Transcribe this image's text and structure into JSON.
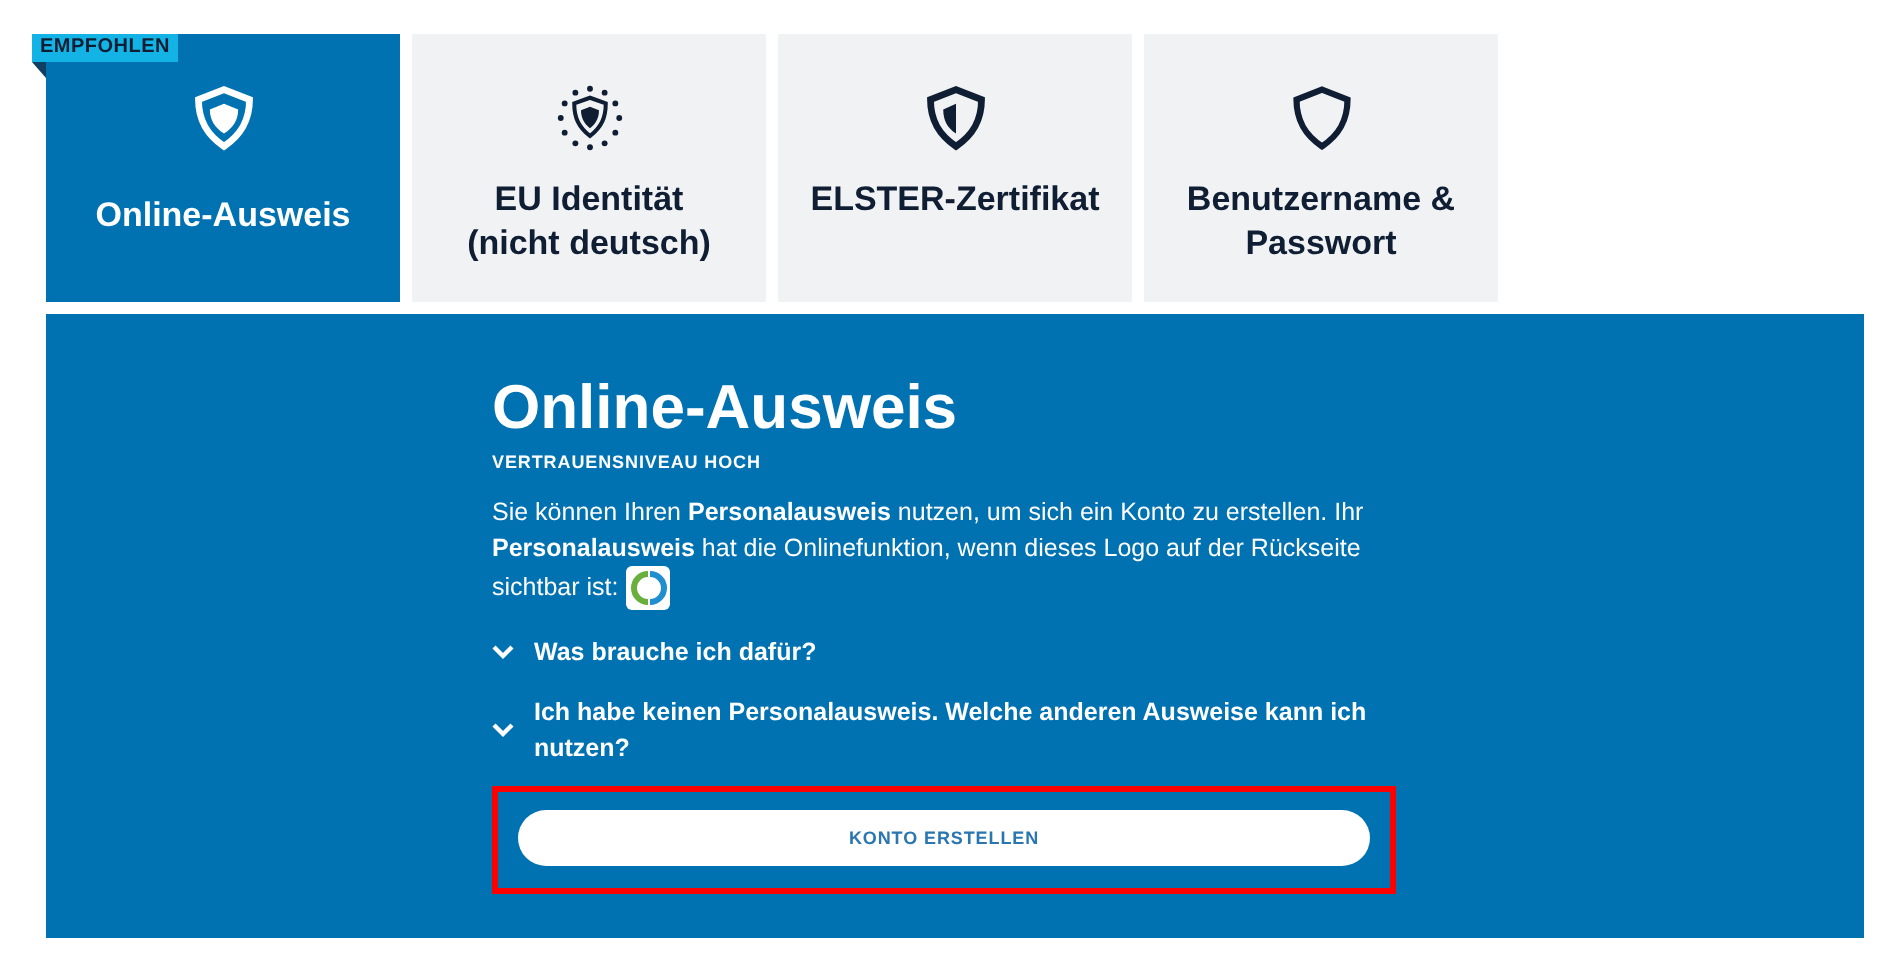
{
  "tabs": [
    {
      "badge": "EMPFOHLEN",
      "label": "Online-Ausweis",
      "kind": "shield",
      "selected": true
    },
    {
      "label": "EU Identität (nicht deutsch)",
      "kind": "eu_shield",
      "selected": false
    },
    {
      "label": "ELSTER-Zertifikat",
      "kind": "half_shield",
      "selected": false
    },
    {
      "label": "Benutzername & Passwort",
      "kind": "outline_shield",
      "selected": false
    }
  ],
  "panel": {
    "title": "Online-Ausweis",
    "subtitle": "VERTRAUENSNIVEAU HOCH",
    "description": "Sie können Ihren **Personalausweis** nutzen, um sich ein Konto zu erstellen. Ihr **Personalausweis** hat die Onlinefunktion, wenn dieses Logo auf der Rückseite",
    "logo_caption": "sichtbar ist:",
    "accordions": [
      {
        "label": "Was brauche ich dafür?",
        "expanded": false
      },
      {
        "label": "Ich habe keinen Personalausweis. Welche anderen Ausweise kann ich nutzen?",
        "expanded": false
      }
    ],
    "button": {
      "label": "KONTO ERSTELLEN",
      "highlighted": true
    }
  }
}
